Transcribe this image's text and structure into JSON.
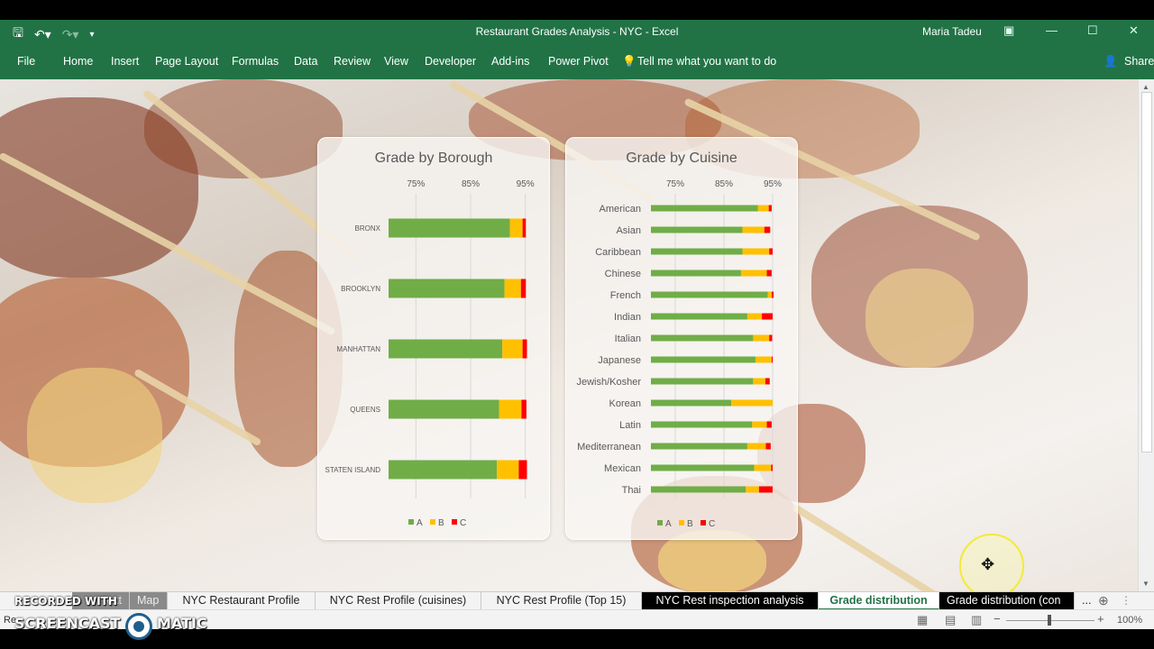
{
  "app": {
    "title": "Restaurant Grades Analysis - NYC  -  Excel",
    "user": "Maria Tadeu",
    "accent": "#217346"
  },
  "ribbon": {
    "tabs": [
      "File",
      "Home",
      "Insert",
      "Page Layout",
      "Formulas",
      "Data",
      "Review",
      "View",
      "Developer",
      "Add-ins",
      "Power Pivot"
    ],
    "tell_me": "Tell me what you want to do",
    "share": "Share"
  },
  "sheet_tabs": {
    "items": [
      "Map",
      "NYC Restaurant Profile",
      "NYC Rest Profile (cuisines)",
      "NYC Rest Profile (Top 15)",
      "NYC Rest inspection analysis",
      "Grade distribution",
      "Grade distribution (con"
    ],
    "partial_first": "text",
    "active": "Grade distribution",
    "more": "..."
  },
  "status": {
    "left": "Re",
    "zoom": "100%"
  },
  "watermark": {
    "line1": "RECORDED WITH",
    "line2a": "SCREENCAST",
    "line2b": "MATIC"
  },
  "chart_data": [
    {
      "type": "bar",
      "title": "Grade by Borough",
      "stacked": true,
      "orientation": "horizontal",
      "xlim": [
        70,
        100
      ],
      "xticks": [
        "75%",
        "85%",
        "95%"
      ],
      "xtick_values": [
        75,
        85,
        95
      ],
      "categories": [
        "BRONX",
        "BROOKLYN",
        "MANHATTAN",
        "QUEENS",
        "STATEN ISLAND"
      ],
      "series": [
        {
          "name": "A",
          "color": "#70ad47",
          "values": [
            92.2,
            91.2,
            90.8,
            90.2,
            89.8
          ]
        },
        {
          "name": "B",
          "color": "#ffc000",
          "values": [
            2.3,
            3.0,
            3.7,
            4.1,
            4.0
          ]
        },
        {
          "name": "C",
          "color": "#ff0000",
          "values": [
            0.6,
            0.9,
            0.8,
            0.9,
            1.5
          ]
        }
      ],
      "legend": "bottom"
    },
    {
      "type": "bar",
      "title": "Grade by Cuisine",
      "stacked": true,
      "orientation": "horizontal",
      "xlim": [
        70,
        100
      ],
      "xticks": [
        "75%",
        "85%",
        "95%"
      ],
      "xtick_values": [
        75,
        85,
        95
      ],
      "categories": [
        "American",
        "Asian",
        "Caribbean",
        "Chinese",
        "French",
        "Indian",
        "Italian",
        "Japanese",
        "Jewish/Kosher",
        "Korean",
        "Latin",
        "Mediterranean",
        "Mexican",
        "Thai"
      ],
      "series": [
        {
          "name": "A",
          "color": "#70ad47",
          "values": [
            92.0,
            88.8,
            88.8,
            88.5,
            94.0,
            89.8,
            91.0,
            91.5,
            91.0,
            86.5,
            90.8,
            89.8,
            91.2,
            89.5
          ]
        },
        {
          "name": "B",
          "color": "#ffc000",
          "values": [
            2.2,
            4.5,
            5.5,
            5.3,
            0.8,
            3.0,
            3.3,
            3.3,
            2.5,
            8.5,
            3.0,
            3.8,
            3.5,
            2.7
          ]
        },
        {
          "name": "C",
          "color": "#ff0000",
          "values": [
            0.6,
            1.2,
            0.7,
            1.0,
            0.4,
            2.2,
            0.6,
            0.2,
            0.9,
            0.0,
            1.0,
            1.0,
            0.3,
            2.8
          ]
        }
      ],
      "legend": "bottom"
    }
  ]
}
